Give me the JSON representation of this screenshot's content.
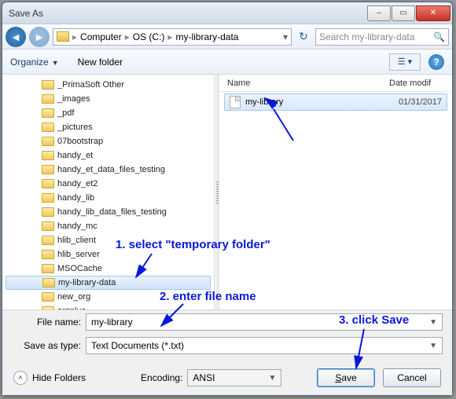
{
  "title": "Save As",
  "breadcrumb": [
    "Computer",
    "OS (C:)",
    "my-library-data"
  ],
  "search_placeholder": "Search my-library-data",
  "toolbar": {
    "organize": "Organize",
    "newfolder": "New folder"
  },
  "tree": [
    {
      "label": "_PrimaSoft Other"
    },
    {
      "label": "_images"
    },
    {
      "label": "_pdf"
    },
    {
      "label": "_pictures"
    },
    {
      "label": "07bootstrap"
    },
    {
      "label": "handy_et"
    },
    {
      "label": "handy_et_data_files_testing"
    },
    {
      "label": "handy_et2"
    },
    {
      "label": "handy_lib"
    },
    {
      "label": "handy_lib_data_files_testing"
    },
    {
      "label": "handy_mc"
    },
    {
      "label": "hlib_client"
    },
    {
      "label": "hlib_server"
    },
    {
      "label": "MSOCache"
    },
    {
      "label": "my-library-data",
      "selected": true
    },
    {
      "label": "new_org"
    },
    {
      "label": "orgplus"
    }
  ],
  "columns": {
    "name": "Name",
    "date": "Date modif"
  },
  "files": [
    {
      "name": "my-library",
      "date": "01/31/2017"
    }
  ],
  "form": {
    "filename_label": "File name:",
    "filename_value": "my-library",
    "saveastype_label": "Save as type:",
    "saveastype_value": "Text Documents (*.txt)",
    "encoding_label": "Encoding:",
    "encoding_value": "ANSI",
    "hide_folders": "Hide Folders",
    "save": "Save",
    "cancel": "Cancel"
  },
  "annotations": {
    "a1": "1. select \"temporary folder\"",
    "a2": "2. enter file name",
    "a3": "3. click Save"
  }
}
